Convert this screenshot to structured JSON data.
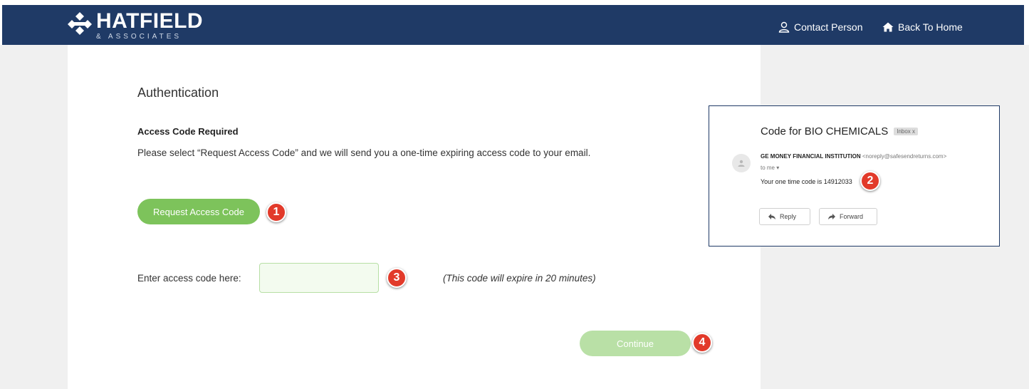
{
  "header": {
    "logo_name": "HATFIELD",
    "logo_sub": "& ASSOCIATES",
    "contact_label": "Contact Person",
    "home_label": "Back To Home",
    "bar_color": "#1f3a66"
  },
  "main": {
    "title": "Authentication",
    "subtitle": "Access Code Required",
    "description": "Please select “Request Access Code” and we will send you a one-time expiring access code to your email.",
    "request_button": "Request Access Code",
    "code_label": "Enter access code here:",
    "code_value": "",
    "expire_note": "(This code will expire in 20 minutes)",
    "continue_button": "Continue",
    "accent_color": "#7dc35b"
  },
  "email": {
    "subject": "Code for BIO CHEMICALS",
    "inbox_tag": "Inbox x",
    "sender_name": "GE MONEY FINANCIAL INSTITUTION",
    "sender_email": "<noreply@safesendreturns.com>",
    "to_line": "to me ▾",
    "body": "Your one time code is 14912033",
    "reply_label": "Reply",
    "forward_label": "Forward"
  },
  "steps": {
    "step1": "1",
    "step2": "2",
    "step3": "3",
    "step4": "4",
    "badge_color": "#e23a2a"
  },
  "icons": {
    "logo": "hatfield-logo-icon",
    "contact": "person-icon",
    "home": "home-icon",
    "avatar": "person-avatar-icon",
    "reply": "reply-arrow-icon",
    "forward": "forward-arrow-icon"
  }
}
